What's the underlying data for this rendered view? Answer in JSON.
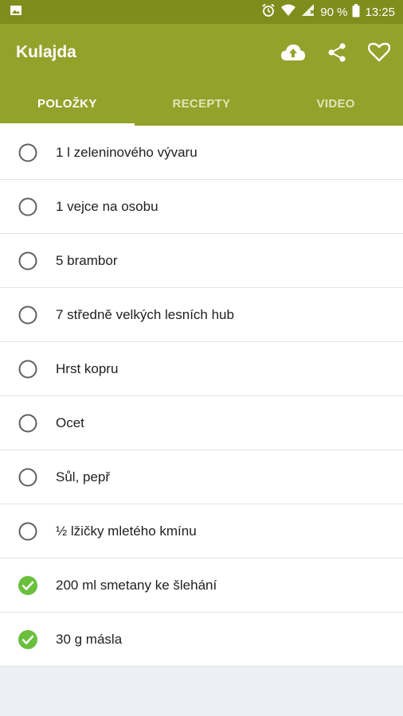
{
  "status_bar": {
    "battery": "90 %",
    "time": "13:25",
    "icons": [
      "image-icon",
      "alarm-icon",
      "wifi-icon",
      "signal-icon",
      "battery-icon"
    ]
  },
  "app_bar": {
    "title": "Kulajda",
    "actions": [
      "cloud-upload-icon",
      "share-icon",
      "heart-icon"
    ]
  },
  "tabs": [
    {
      "label": "POLOŽKY",
      "active": true
    },
    {
      "label": "RECEPTY",
      "active": false
    },
    {
      "label": "VIDEO",
      "active": false
    }
  ],
  "items": [
    {
      "label": "1 l zeleninového vývaru",
      "checked": false
    },
    {
      "label": "1 vejce na osobu",
      "checked": false
    },
    {
      "label": "5 brambor",
      "checked": false
    },
    {
      "label": "7 středně velkých lesních hub",
      "checked": false
    },
    {
      "label": "Hrst kopru",
      "checked": false
    },
    {
      "label": "Ocet",
      "checked": false
    },
    {
      "label": "Sůl, pepř",
      "checked": false
    },
    {
      "label": "½ lžičky mletého kmínu",
      "checked": false
    },
    {
      "label": "200 ml smetany ke šlehání",
      "checked": true
    },
    {
      "label": "30 g másla",
      "checked": true
    }
  ],
  "colors": {
    "primary": "#93a22b",
    "status_bar": "#7f8d1d",
    "checked": "#6abf3d"
  }
}
